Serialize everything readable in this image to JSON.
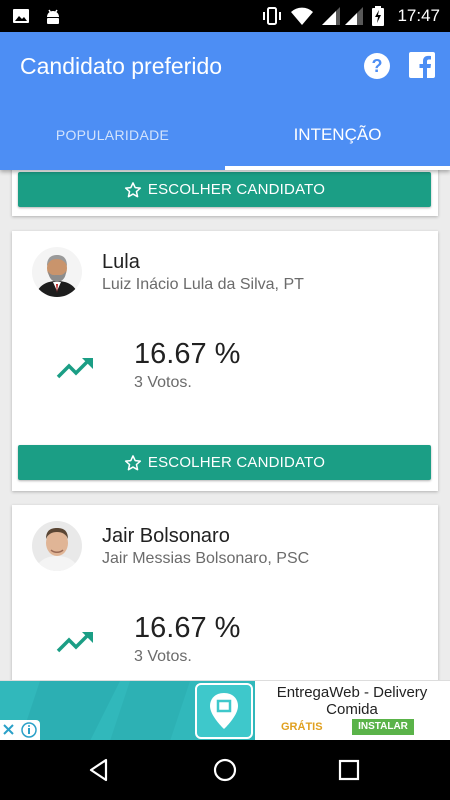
{
  "status_bar": {
    "time": "17:47"
  },
  "app_bar": {
    "title": "Candidato preferido",
    "help_icon": "help-circle-icon",
    "facebook_icon": "facebook-icon"
  },
  "tabs": [
    {
      "label": "POPULARIDADE",
      "selected": false
    },
    {
      "label": "INTENÇÃO",
      "selected": true
    }
  ],
  "choose_button_label": "ESCOLHER CANDIDATO",
  "candidates": [
    {
      "name": "Lula",
      "full_name": "Luiz Inácio Lula da Silva, PT",
      "percent": "16.67 %",
      "votes": "3 Votos.",
      "button_label": "ESCOLHER CANDIDATO"
    },
    {
      "name": "Jair Bolsonaro",
      "full_name": "Jair Messias Bolsonaro, PSC",
      "percent": "16.67 %",
      "votes": "3 Votos."
    }
  ],
  "ad": {
    "title": "EntregaWeb - Delivery Comida",
    "price": "GRÁTIS",
    "install": "INSTALAR"
  },
  "colors": {
    "app_bar": "#4d8ef4",
    "button": "#1b9e85",
    "trend": "#1b9e85"
  }
}
